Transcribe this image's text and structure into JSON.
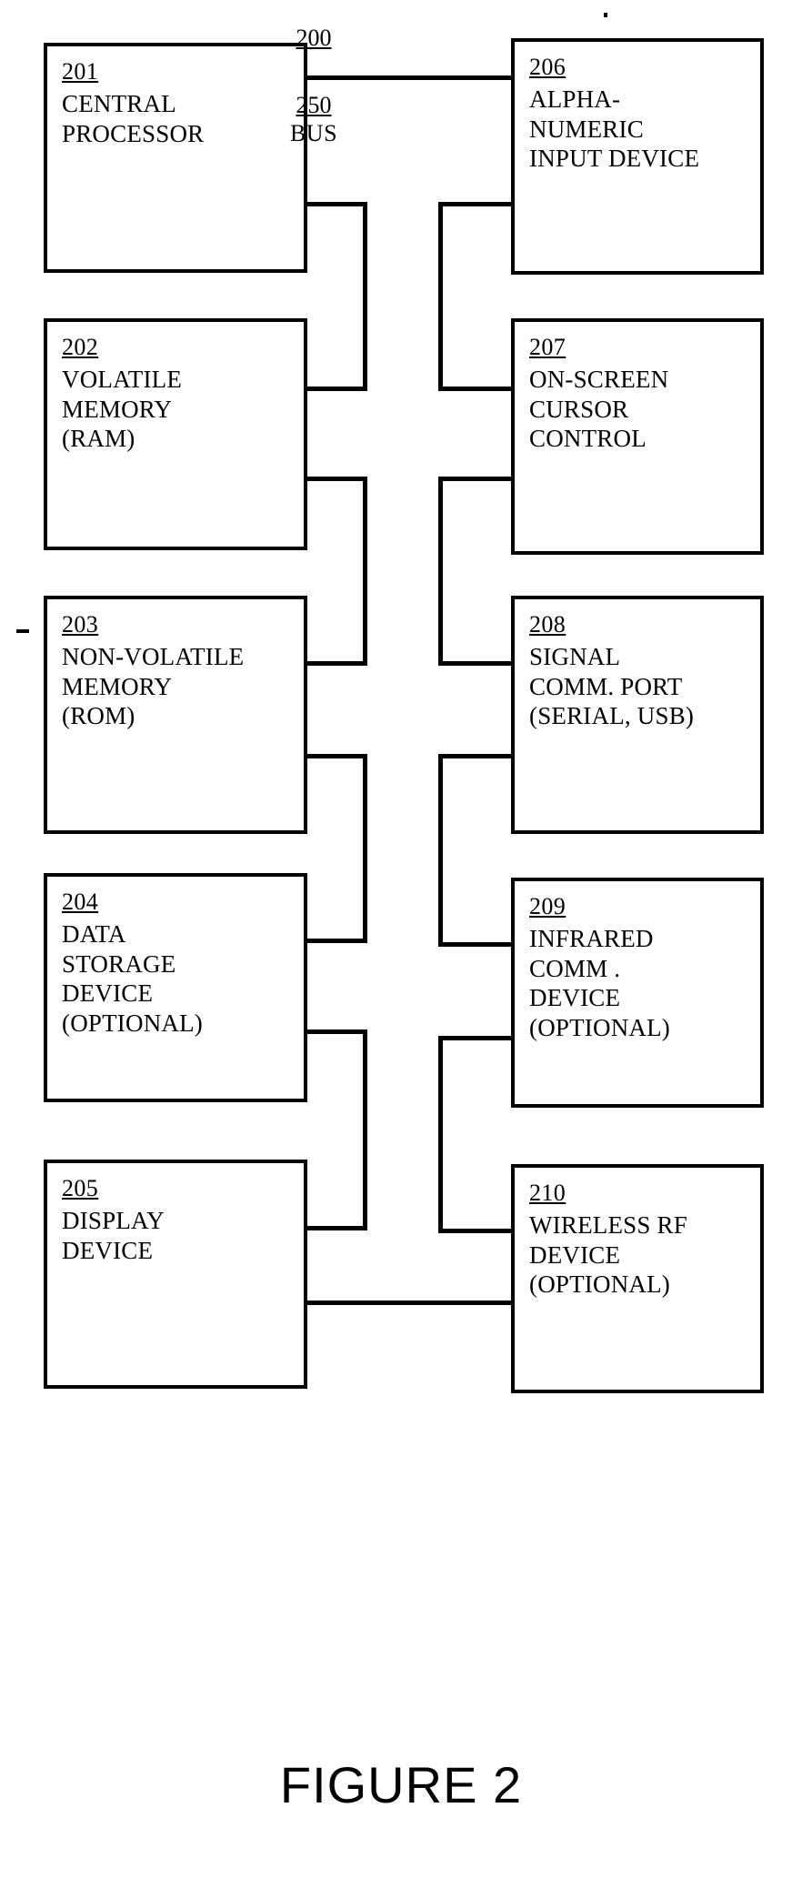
{
  "figure": {
    "caption": "FIGURE 2",
    "system_ref": "200",
    "bus_ref": "250",
    "bus_label": "BUS"
  },
  "blocks": [
    {
      "ref": "201",
      "label": "CENTRAL\nPROCESSOR",
      "column": "left"
    },
    {
      "ref": "202",
      "label": "VOLATILE\nMEMORY\n(RAM)",
      "column": "left"
    },
    {
      "ref": "203",
      "label": "NON-VOLATILE\nMEMORY\n(ROM)",
      "column": "left"
    },
    {
      "ref": "204",
      "label": "DATA\nSTORAGE\nDEVICE\n(OPTIONAL)",
      "column": "left"
    },
    {
      "ref": "205",
      "label": "DISPLAY\nDEVICE",
      "column": "left"
    },
    {
      "ref": "206",
      "label": "ALPHA-\nNUMERIC\nINPUT DEVICE",
      "column": "right"
    },
    {
      "ref": "207",
      "label": "ON-SCREEN\nCURSOR\nCONTROL",
      "column": "right"
    },
    {
      "ref": "208",
      "label": "SIGNAL\nCOMM. PORT\n(SERIAL, USB)",
      "column": "right"
    },
    {
      "ref": "209",
      "label": "INFRARED\nCOMM .\nDEVICE\n(OPTIONAL)",
      "column": "right"
    },
    {
      "ref": "210",
      "label": "WIRELESS RF\nDEVICE\n(OPTIONAL)",
      "column": "right"
    }
  ],
  "colors": {
    "ink": "#000000",
    "page": "#ffffff"
  }
}
